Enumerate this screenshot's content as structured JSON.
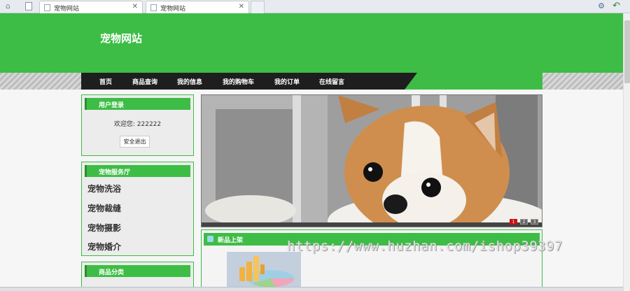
{
  "browser": {
    "tabs": [
      {
        "label": "宠物网站"
      },
      {
        "label": "宠物网站"
      }
    ]
  },
  "header": {
    "site_title": "宠物网站"
  },
  "nav": {
    "items": [
      "首页",
      "商品查询",
      "我的信息",
      "我的购物车",
      "我的订单",
      "在线留言"
    ]
  },
  "login_box": {
    "title": "用户登录",
    "welcome": "欢迎您: 222222",
    "logout_label": "安全退出"
  },
  "service_box": {
    "title": "宠物服务厅",
    "items": [
      "宠物洗浴",
      "宠物裁缝",
      "宠物摄影",
      "宠物婚介"
    ]
  },
  "category_box": {
    "title": "商品分类"
  },
  "banner": {
    "pages": [
      "1",
      "2",
      "3"
    ],
    "active_page": "1"
  },
  "new_products": {
    "title": "新品上架"
  },
  "watermark": "https://www.huzhan.com/ishop39397",
  "colors": {
    "brand_green": "#3dbd45",
    "nav_dark": "#1e1e1e",
    "active_dot": "#cc1111"
  }
}
